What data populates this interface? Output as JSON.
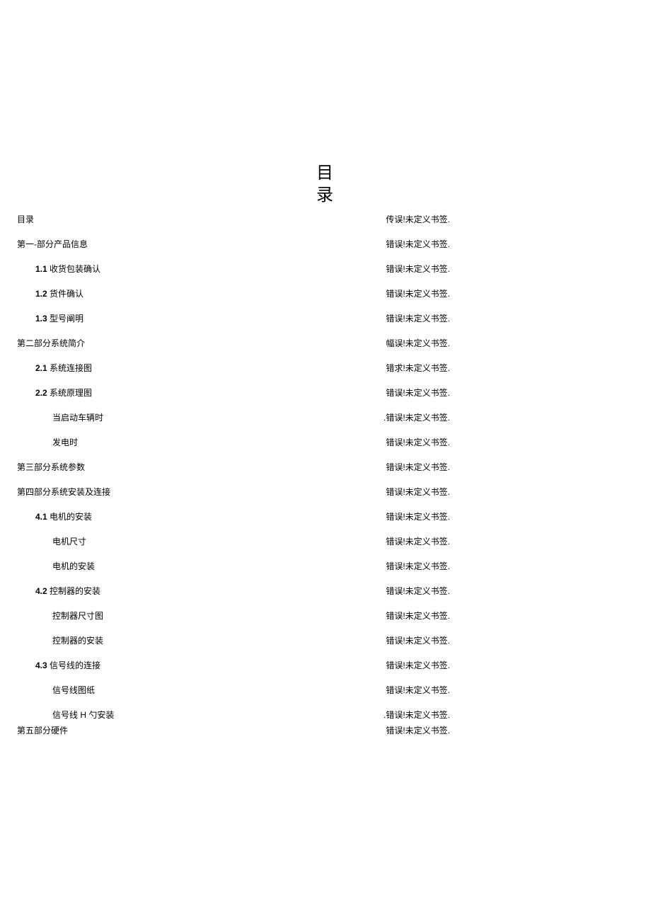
{
  "title_char1": "目",
  "title_char2": "录",
  "toc": [
    {
      "left": "目录",
      "right": "传误!未定义书签.",
      "indent": 0,
      "bold": false
    },
    {
      "left_bold": "",
      "left": "第一-部分产品信息",
      "right": "错误!未定义书签.",
      "indent": 0,
      "bold": false
    },
    {
      "left_bold": "1.1",
      "left": " 收货包装确认",
      "right": "错误!未定义书签.",
      "indent": 1,
      "bold": true
    },
    {
      "left_bold": "1.2",
      "left": " 货件确认",
      "right": "错误!未定义书签.",
      "indent": 1,
      "bold": true
    },
    {
      "left_bold": "1.3",
      "left": " 型号阐明",
      "right": "错误!未定义书签.",
      "indent": 1,
      "bold": true
    },
    {
      "left_bold": "",
      "left": "第二部分系统简介",
      "right": "幅误!未定义书签.",
      "indent": 0,
      "bold": false
    },
    {
      "left_bold": "2.1",
      "left": " 系统连接图",
      "right": "错求!未定义书签.",
      "indent": 1,
      "bold": true
    },
    {
      "left_bold": "2.2",
      "left": " 系统原理图",
      "right": "错误!未定义书签.",
      "indent": 1,
      "bold": true
    },
    {
      "left_bold": "",
      "left": "当启动车辆时",
      "right": ".错误!未定义书签.",
      "indent": 2,
      "bold": false
    },
    {
      "left_bold": "",
      "left": "发电时",
      "right": "错误!未定义书签.",
      "indent": 2,
      "bold": false
    },
    {
      "left_bold": "",
      "left": "第三部分系统参数",
      "right": "错误!未定义书签.",
      "indent": 0,
      "bold": false
    },
    {
      "left_bold": "",
      "left": "第四部分系统安装及连接",
      "right": "错误!未定义书签.",
      "indent": 0,
      "bold": false
    },
    {
      "left_bold": "4.1",
      "left": " 电机的安装",
      "right": "错误!未定义书签.",
      "indent": 1,
      "bold": true
    },
    {
      "left_bold": "",
      "left": "电机尺寸",
      "right": "错误!未定义书签.",
      "indent": 2,
      "bold": false
    },
    {
      "left_bold": "",
      "left": "电机的安装",
      "right": "错误!未定义书签.",
      "indent": 2,
      "bold": false
    },
    {
      "left_bold": "4.2",
      "left": " 控制器的安装",
      "right": "错误!未定义书签.",
      "indent": 1,
      "bold": true
    },
    {
      "left_bold": "",
      "left": "控制器尺寸图",
      "right": "错误!未定义书签.",
      "indent": 2,
      "bold": false
    },
    {
      "left_bold": "",
      "left": "控制器的安装",
      "right": "错误!未定义书签.",
      "indent": 2,
      "bold": false
    },
    {
      "left_bold": "4.3",
      "left": " 信号线的连接",
      "right": "错误!未定义书签.",
      "indent": 1,
      "bold": true
    },
    {
      "left_bold": "",
      "left": "信号线图纸",
      "right": "错误!未定义书签.",
      "indent": 2,
      "bold": false
    },
    {
      "left_bold": "",
      "left": "信号线 H 勺安装",
      "right": ".错误!未定义书签.",
      "indent": 2,
      "bold": false,
      "wrap": true
    },
    {
      "left_bold": "",
      "left": "第五部分硬件",
      "right": "错误!未定义书签.",
      "indent": 0,
      "bold": false
    }
  ]
}
